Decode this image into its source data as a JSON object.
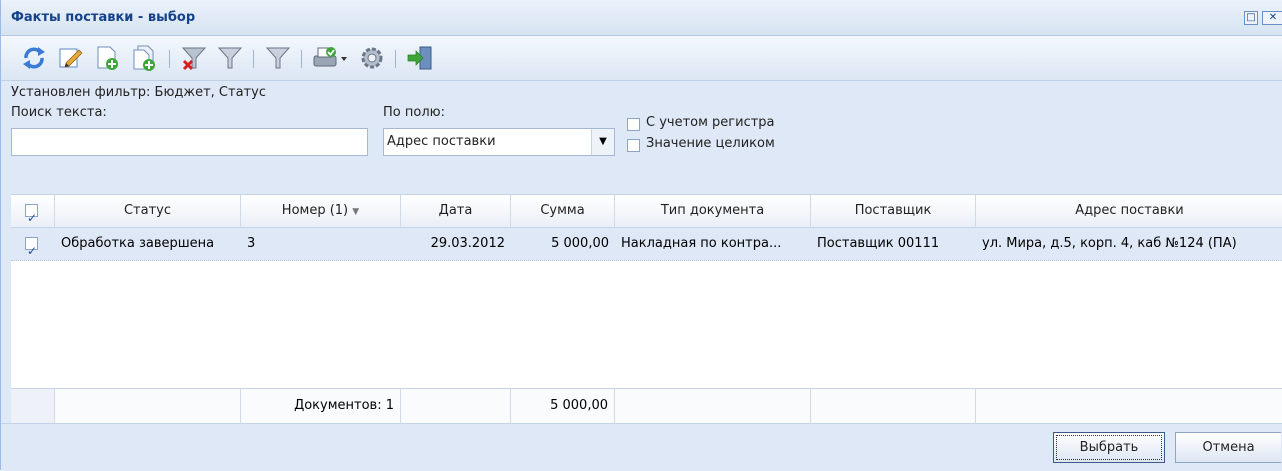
{
  "window": {
    "title": "Факты поставки - выбор"
  },
  "toolbar": {
    "icons": [
      "refresh-icon",
      "edit-icon",
      "add-document-icon",
      "copy-document-icon",
      "clear-filter-icon",
      "filter-icon",
      "set-filter-icon",
      "print-icon",
      "settings-icon",
      "exit-icon"
    ]
  },
  "filter": {
    "status_text": "Установлен фильтр: Бюджет, Статус",
    "search_label": "Поиск текста:",
    "search_value": "",
    "field_label": "По полю:",
    "field_value": "Адрес поставки",
    "case_label": "С учетом регистра",
    "whole_label": "Значение целиком"
  },
  "grid": {
    "columns": [
      "Статус",
      "Номер (1)",
      "Дата",
      "Сумма",
      "Тип документа",
      "Поставщик",
      "Адрес поставки"
    ],
    "rows": [
      {
        "status": "Обработка завершена",
        "number": "3",
        "date": "29.03.2012",
        "sum": "5 000,00",
        "doc_type": "Накладная по контра...",
        "supplier": "Поставщик 00111",
        "address": "ул. Мира, д.5, корп. 4, каб №124 (ПА)"
      }
    ],
    "footer": {
      "documents": "Документов: 1",
      "sum_total": "5 000,00"
    }
  },
  "buttons": {
    "select": "Выбрать",
    "cancel": "Отмена"
  },
  "colors": {
    "accent": "#15428b",
    "background": "#dfe8f6",
    "selected_row": "#dfe8f6"
  }
}
